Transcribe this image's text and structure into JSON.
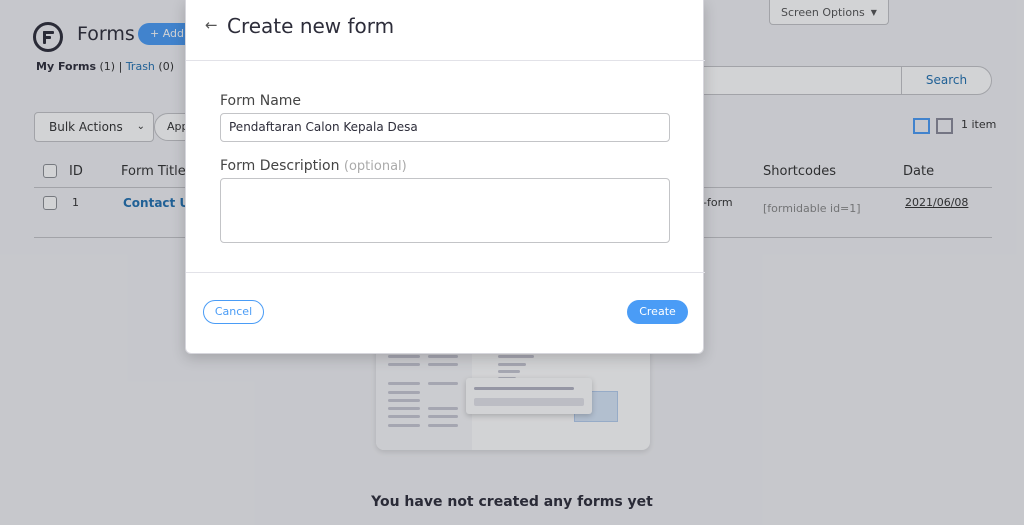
{
  "header": {
    "screen_options": "Screen Options",
    "title": "Forms",
    "add_new": "+ Add New"
  },
  "views": {
    "my_forms": "My Forms",
    "my_forms_count": "(1)",
    "separator": "|",
    "trash": "Trash",
    "trash_count": "(0)"
  },
  "toolbar": {
    "bulk_actions": "Bulk Actions",
    "apply": "Apply",
    "search": "Search",
    "item_count": "1 item"
  },
  "table": {
    "columns": {
      "id": "ID",
      "title": "Form Title",
      "shortcodes": "Shortcodes",
      "date": "Date"
    },
    "rows": [
      {
        "id": "1",
        "title": "Contact Us",
        "key": "-form",
        "shortcode": "[formidable id=1]",
        "date": "2021/06/08"
      }
    ]
  },
  "empty_message": "You have not created any forms yet",
  "modal": {
    "back_icon": "←",
    "title": "Create new form",
    "name_label": "Form Name",
    "name_value": "Pendaftaran Calon Kepala Desa",
    "desc_label": "Form Description",
    "desc_optional": "(optional)",
    "desc_value": "",
    "cancel": "Cancel",
    "create": "Create"
  },
  "colors": {
    "accent": "#4a9cf6",
    "link": "#2271b1"
  }
}
